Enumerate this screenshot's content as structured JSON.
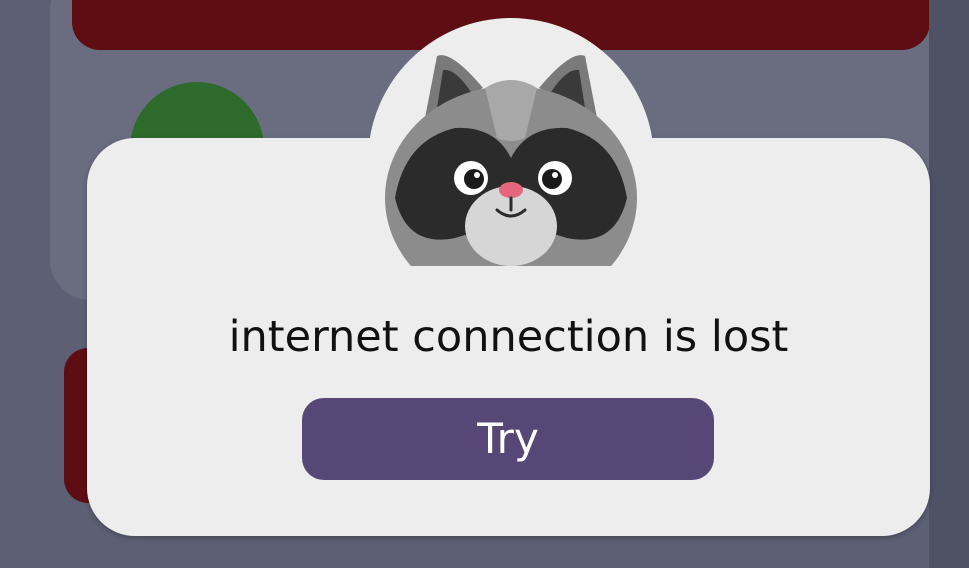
{
  "dialog": {
    "message": "internet connection is lost",
    "try_label": "Try",
    "mascot_icon": "raccoon-icon"
  },
  "colors": {
    "overlay": "#5d6075",
    "dialog_bg": "#ededed",
    "button_bg": "#574777",
    "button_text": "#ffffff",
    "background_red": "#5e0d12",
    "background_green": "#2e6a2c"
  }
}
